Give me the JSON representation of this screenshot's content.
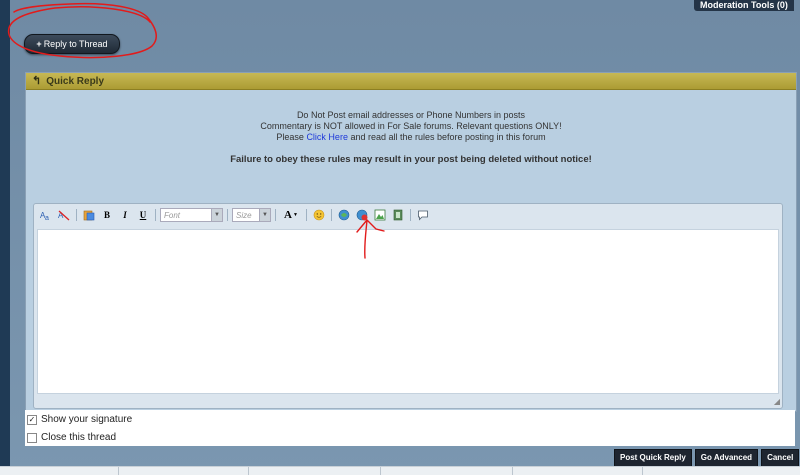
{
  "header": {
    "moderation_tools": "Moderation Tools (0)",
    "reply_button": "Reply to Thread"
  },
  "quick_reply": {
    "title": "Quick Reply",
    "rules": {
      "line1": "Do Not Post email addresses or Phone Numbers in posts",
      "line2": "Commentary is NOT allowed in For Sale forums. Relevant questions ONLY!",
      "line3_pre": "Please ",
      "line3_link": "Click Here",
      "line3_post": " and read all the rules before posting in this forum",
      "line4": "Failure to obey these rules may result in your post being deleted without notice!"
    },
    "toolbar": {
      "font_placeholder": "Font",
      "size_placeholder": "Size",
      "font_color_label": "A"
    },
    "options": {
      "show_signature": "Show your signature",
      "close_thread": "Close this thread"
    },
    "buttons": {
      "post_quick_reply": "Post Quick Reply",
      "go_advanced": "Go Advanced",
      "cancel": "Cancel"
    }
  },
  "colors": {
    "panel_header": "#b8a83f",
    "link": "#1f3ad9",
    "annotation": "#e21b1b"
  }
}
